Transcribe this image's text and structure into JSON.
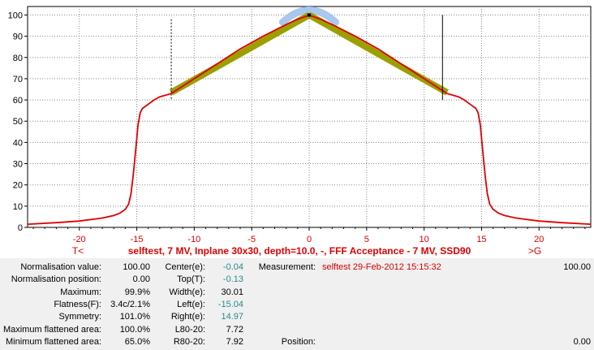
{
  "chart_data": {
    "type": "line",
    "x_ticks": [
      -20,
      -15,
      -10,
      -5,
      0,
      5,
      10,
      15,
      20
    ],
    "y_ticks": [
      0,
      10,
      20,
      30,
      40,
      50,
      60,
      70,
      80,
      90,
      100
    ],
    "xlim": [
      -24.5,
      24.5
    ],
    "ylim": [
      0,
      104
    ],
    "grid": true,
    "title": "selftest, 7 MV, Inplane 30x30, depth=10.0, -, FFF Acceptance - 7 MV, SSD90",
    "left_marker": "T<",
    "right_marker": ">G",
    "profile": {
      "x": [
        -24.5,
        -22,
        -20,
        -18,
        -17,
        -16.5,
        -16,
        -15.7,
        -15.5,
        -15.3,
        -15.1,
        -15.0,
        -14.9,
        -14.7,
        -14.5,
        -14,
        -13.5,
        -13,
        -12,
        -10,
        -8,
        -6,
        -4,
        -2,
        -1,
        0,
        1,
        2,
        4,
        6,
        8,
        10,
        12,
        13,
        13.5,
        14,
        14.5,
        14.7,
        14.9,
        15.0,
        15.1,
        15.3,
        15.5,
        15.7,
        16,
        16.5,
        17,
        18,
        20,
        22,
        24.5
      ],
      "y": [
        1.5,
        2.2,
        3.0,
        4.4,
        5.6,
        6.6,
        8.5,
        11,
        16,
        25,
        36,
        42,
        48,
        54,
        56,
        58,
        60,
        61.5,
        63,
        70,
        77,
        84,
        90,
        95.5,
        98,
        99.9,
        98,
        95.5,
        90,
        84,
        77,
        70,
        63,
        61.5,
        60,
        58,
        56,
        54,
        48,
        42,
        36,
        25,
        16,
        11,
        8.5,
        6.6,
        5.6,
        4.4,
        3.0,
        2.2,
        1.5
      ]
    },
    "flattened_line_left": {
      "x": [
        -12,
        0
      ],
      "y": [
        63.5,
        100
      ]
    },
    "flattened_line_right": {
      "x": [
        0,
        12
      ],
      "y": [
        100,
        63.5
      ]
    },
    "top_marker": {
      "x": 0,
      "y": 100
    },
    "left_marker_x": -12,
    "right_marker_x": 11.6
  },
  "info": {
    "labels": [
      "Normalisation value:",
      "Normalisation position:",
      "Maximum:",
      "Flatness(F):",
      "Symmetry:",
      "Maximum flattened area:",
      "Minimum flattened area:"
    ],
    "values": [
      "100.00",
      "0.00",
      "99.9%",
      "3.4c/2.1%",
      "101.0%",
      "100.0%",
      "65.0%"
    ],
    "labels2": [
      "Center(e):",
      "Top(T):",
      "Width(e):",
      "Left(e):",
      "Right(e):",
      "L80-20:",
      "R80-20:"
    ],
    "values2": [
      "-0.04",
      "-0.13",
      "30.01",
      "-15.04",
      "14.97",
      "7.72",
      "7.92"
    ],
    "measurement_label": "Measurement:",
    "measurement_value": "selftest 29-Feb-2012 15:15:32",
    "measurement_number": "100.00",
    "position_label": "Position:",
    "position_value": "0.00"
  },
  "colors": {
    "profile": "#e00000",
    "flattened": "#9aa000",
    "top_area": "#a8c8ee",
    "title": "#e00000",
    "teal_values": "#2a8a8a"
  }
}
